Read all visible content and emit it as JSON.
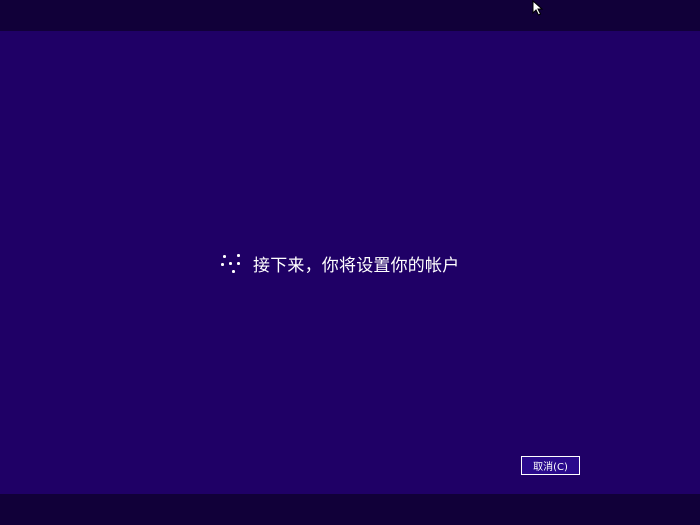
{
  "status": {
    "message": "接下来，你将设置你的帐户",
    "spinner_icon": "loading-spinner-icon"
  },
  "buttons": {
    "cancel_label": "取消(C)"
  },
  "colors": {
    "background": "#1f0066",
    "bars": "#110039",
    "text": "#ffffff",
    "button_fill": "#2a0a8c"
  }
}
